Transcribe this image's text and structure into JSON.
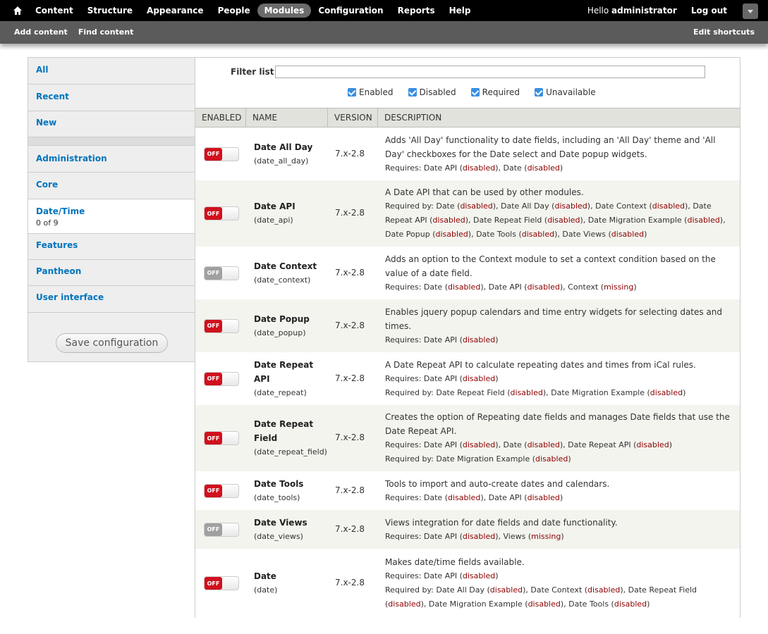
{
  "toolbar": {
    "menu": [
      "Content",
      "Structure",
      "Appearance",
      "People",
      "Modules",
      "Configuration",
      "Reports",
      "Help"
    ],
    "hello_prefix": "Hello ",
    "username": "administrator",
    "logout": "Log out"
  },
  "shortcuts": {
    "links": [
      "Add content",
      "Find content"
    ],
    "edit": "Edit shortcuts"
  },
  "sidebar": {
    "tabs": [
      "All",
      "Recent",
      "New",
      "Administration",
      "Core",
      "Date/Time",
      "Features",
      "Pantheon",
      "User interface"
    ],
    "active_count": "0 of 9",
    "save_label": "Save configuration"
  },
  "filter": {
    "label": "Filter list",
    "value": "",
    "checks": [
      "Enabled",
      "Disabled",
      "Required",
      "Unavailable"
    ]
  },
  "table": {
    "headers": [
      "Enabled",
      "Name",
      "Version",
      "Description"
    ],
    "toggle_label": "OFF",
    "rows": [
      {
        "name": "Date All Day",
        "machine": "(date_all_day)",
        "version": "7.x-2.8",
        "available": true,
        "desc": "Adds 'All Day' functionality to date fields, including an 'All Day' theme and 'All Day' checkboxes for the Date select and Date popup widgets.",
        "requires": "Requires: Date API (disabled), Date (disabled)",
        "required_by": ""
      },
      {
        "name": "Date API",
        "machine": "(date_api)",
        "version": "7.x-2.8",
        "available": true,
        "desc": "A Date API that can be used by other modules.",
        "requires": "",
        "required_by": "Required by: Date (disabled), Date All Day (disabled), Date Context (disabled), Date Repeat API (disabled), Date Repeat Field (disabled), Date Migration Example (disabled), Date Popup (disabled), Date Tools (disabled), Date Views (disabled)"
      },
      {
        "name": "Date Context",
        "machine": "(date_context)",
        "version": "7.x-2.8",
        "available": false,
        "desc": "Adds an option to the Context module to set a context condition based on the value of a date field.",
        "requires": "Requires: Date (disabled), Date API (disabled), Context (missing)",
        "required_by": ""
      },
      {
        "name": "Date Popup",
        "machine": "(date_popup)",
        "version": "7.x-2.8",
        "available": true,
        "desc": "Enables jquery popup calendars and time entry widgets for selecting dates and times.",
        "requires": "Requires: Date API (disabled)",
        "required_by": ""
      },
      {
        "name": "Date Repeat API",
        "machine": "(date_repeat)",
        "version": "7.x-2.8",
        "available": true,
        "desc": "A Date Repeat API to calculate repeating dates and times from iCal rules.",
        "requires": "Requires: Date API (disabled)",
        "required_by": "Required by: Date Repeat Field (disabled), Date Migration Example (disabled)"
      },
      {
        "name": "Date Repeat Field",
        "machine": "(date_repeat_field)",
        "version": "7.x-2.8",
        "available": true,
        "desc": "Creates the option of Repeating date fields and manages Date fields that use the Date Repeat API.",
        "requires": "Requires: Date API (disabled), Date (disabled), Date Repeat API (disabled)",
        "required_by": "Required by: Date Migration Example (disabled)"
      },
      {
        "name": "Date Tools",
        "machine": "(date_tools)",
        "version": "7.x-2.8",
        "available": true,
        "desc": "Tools to import and auto-create dates and calendars.",
        "requires": "Requires: Date (disabled), Date API (disabled)",
        "required_by": ""
      },
      {
        "name": "Date Views",
        "machine": "(date_views)",
        "version": "7.x-2.8",
        "available": false,
        "desc": "Views integration for date fields and date functionality.",
        "requires": "Requires: Date API (disabled), Views (missing)",
        "required_by": ""
      },
      {
        "name": "Date",
        "machine": "(date)",
        "version": "7.x-2.8",
        "available": true,
        "desc": "Makes date/time fields available.",
        "requires": "Requires: Date API (disabled)",
        "required_by": "Required by: Date All Day (disabled), Date Context (disabled), Date Repeat Field (disabled), Date Migration Example (disabled), Date Tools (disabled)"
      }
    ]
  },
  "colors": {
    "toggle_off_available": "#d1101d",
    "toggle_off_unavailable": "#a0a0a0",
    "link": "#0074bd",
    "status_text": "#8c0000"
  }
}
